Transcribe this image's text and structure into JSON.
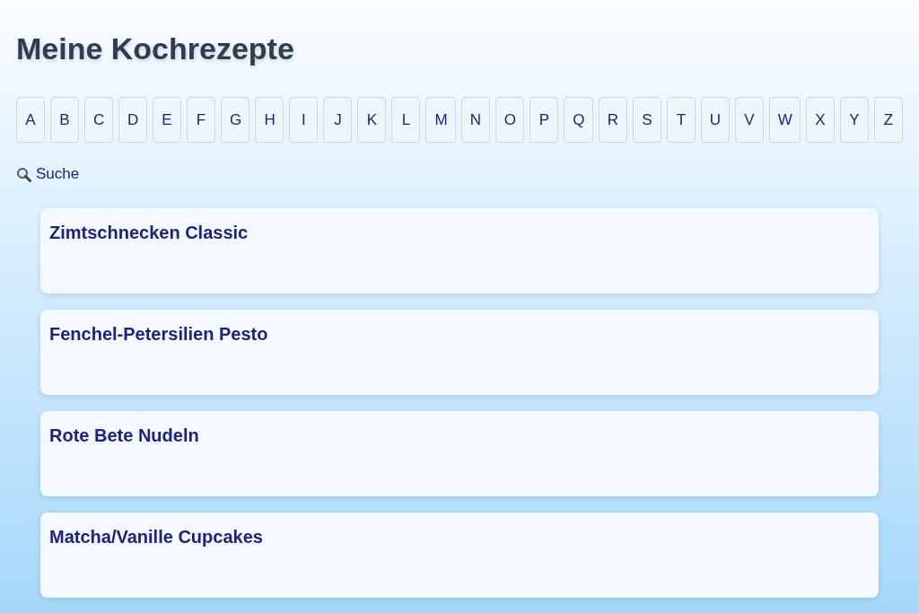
{
  "title": "Meine Kochrezepte",
  "letters": [
    "A",
    "B",
    "C",
    "D",
    "E",
    "F",
    "G",
    "H",
    "I",
    "J",
    "K",
    "L",
    "M",
    "N",
    "O",
    "P",
    "Q",
    "R",
    "S",
    "T",
    "U",
    "V",
    "W",
    "X",
    "Y",
    "Z"
  ],
  "search": {
    "label": "Suche"
  },
  "recipes": [
    {
      "title": "Zimtschnecken Classic"
    },
    {
      "title": "Fenchel-Petersilien Pesto"
    },
    {
      "title": "Rote Bete Nudeln"
    },
    {
      "title": "Matcha/Vanille Cupcakes"
    }
  ]
}
